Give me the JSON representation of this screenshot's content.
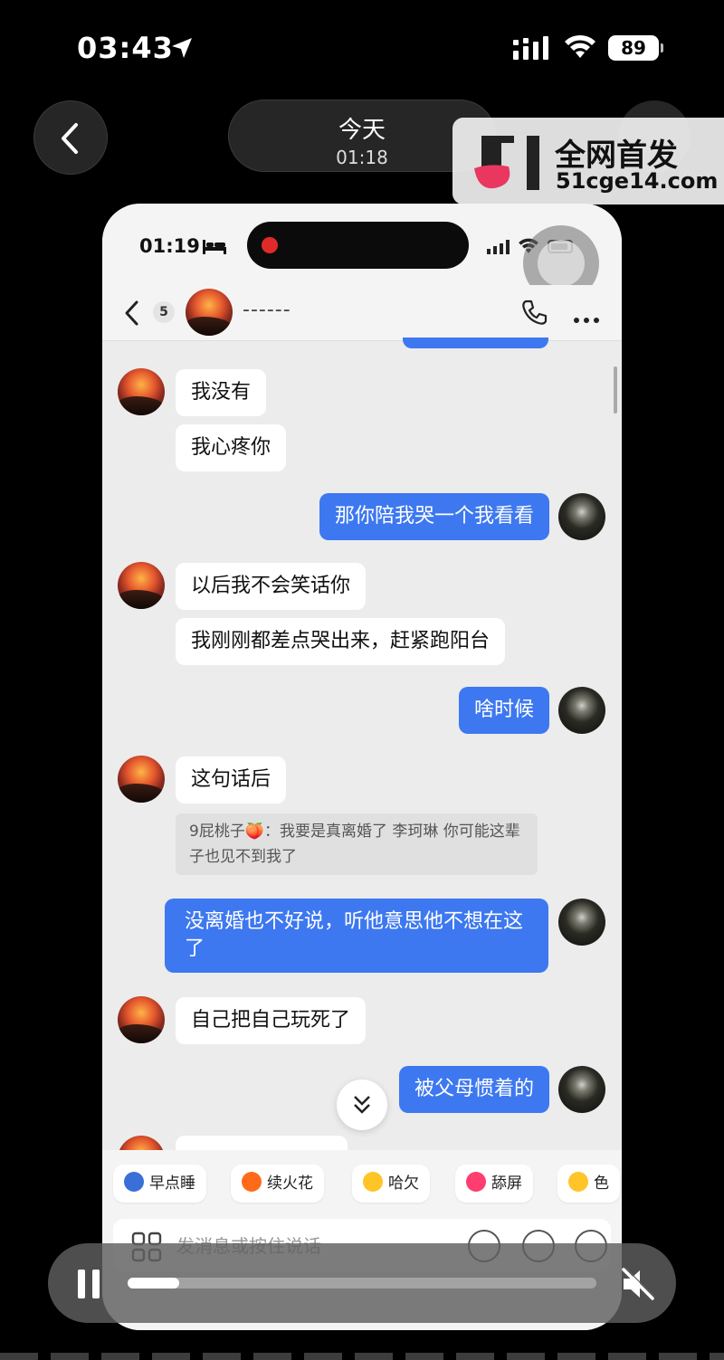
{
  "outer_status": {
    "time": "03:43",
    "battery": "89"
  },
  "nav": {
    "title": "今天",
    "duration": "01:18"
  },
  "watermark": {
    "title": "全网首发",
    "site": "51cge14.com"
  },
  "inner_status": {
    "time": "01:19"
  },
  "chat_header": {
    "unread_count": "5",
    "contact_name": "------"
  },
  "messages": [
    {
      "side": "in",
      "text": "我没有"
    },
    {
      "side": "in",
      "text": "我心疼你"
    },
    {
      "side": "out",
      "text": "那你陪我哭一个我看看"
    },
    {
      "side": "in",
      "text": "以后我不会笑话你"
    },
    {
      "side": "in",
      "text": "我刚刚都差点哭出来，赶紧跑阳台"
    },
    {
      "side": "out",
      "text": "啥时候"
    },
    {
      "side": "in",
      "text": "这句话后"
    },
    {
      "side": "quote",
      "text": "9屁桃子🍑：我要是真离婚了 李珂琳 你可能这辈子也见不到我了"
    },
    {
      "side": "out",
      "text": "没离婚也不好说，听他意思他不想在这了"
    },
    {
      "side": "in",
      "text": "自己把自己玩死了"
    },
    {
      "side": "out",
      "text": "被父母惯着的"
    }
  ],
  "quick_replies": [
    {
      "label": "早点睡",
      "color": "#3b6fd8"
    },
    {
      "label": "续火花",
      "color": "#ff6a1a"
    },
    {
      "label": "哈欠",
      "color": "#ffc428"
    },
    {
      "label": "舔屏",
      "color": "#ff3d6e"
    },
    {
      "label": "色",
      "color": "#ffc428"
    }
  ],
  "input": {
    "placeholder": "发消息或按住说话"
  },
  "video": {
    "progress": 0.11,
    "state": "playing",
    "muted": true
  }
}
